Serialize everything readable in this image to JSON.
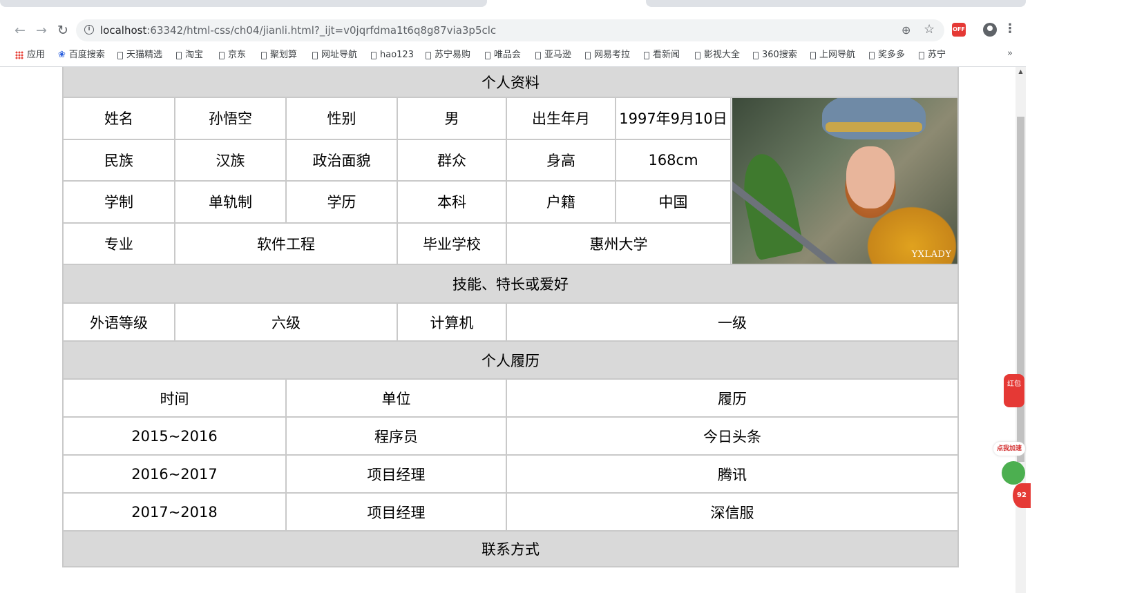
{
  "browser": {
    "url_host": "localhost",
    "url_rest": ":63342/html-css/ch04/jianli.html?_ijt=v0jqrfdma1t6q8g87via3p5clc",
    "ext_badge": "OFF"
  },
  "bookmarks": [
    "百度搜索",
    "天猫精选",
    "淘宝",
    "京东",
    "聚划算",
    "网址导航",
    "hao123",
    "苏宁易购",
    "唯品会",
    "亚马逊",
    "网易考拉",
    "看新闻",
    "影视大全",
    "360搜索",
    "上网导航",
    "奖多多",
    "苏宁"
  ],
  "bookmarks_apps": "应用",
  "bookmarks_more": "»",
  "resume": {
    "section_personal": "个人资料",
    "name_label": "姓名",
    "name": "孙悟空",
    "gender_label": "性别",
    "gender": "男",
    "birth_label": "出生年月",
    "birth": "1997年9月10日",
    "ethnicity_label": "民族",
    "ethnicity": "汉族",
    "politics_label": "政治面貌",
    "politics": "群众",
    "height_label": "身高",
    "height": "168cm",
    "system_label": "学制",
    "system": "单轨制",
    "education_label": "学历",
    "education": "本科",
    "household_label": "户籍",
    "household": "中国",
    "major_label": "专业",
    "major": "软件工程",
    "school_label": "毕业学校",
    "school": "惠州大学",
    "photo_watermark": "YXLADY",
    "section_skills": "技能、特长或爱好",
    "language_label": "外语等级",
    "language": "六级",
    "computer_label": "计算机",
    "computer": "一级",
    "section_history": "个人履历",
    "history_headers": [
      "时间",
      "单位",
      "履历"
    ],
    "history_rows": [
      [
        "2015~2016",
        "程序员",
        "今日头条"
      ],
      [
        "2016~2017",
        "项目经理",
        "腾讯"
      ],
      [
        "2017~2018",
        "项目经理",
        "深信服"
      ]
    ],
    "section_contact": "联系方式"
  },
  "widgets": {
    "hongbao": "红包",
    "speed": "点我加速",
    "speed_number": "92"
  }
}
